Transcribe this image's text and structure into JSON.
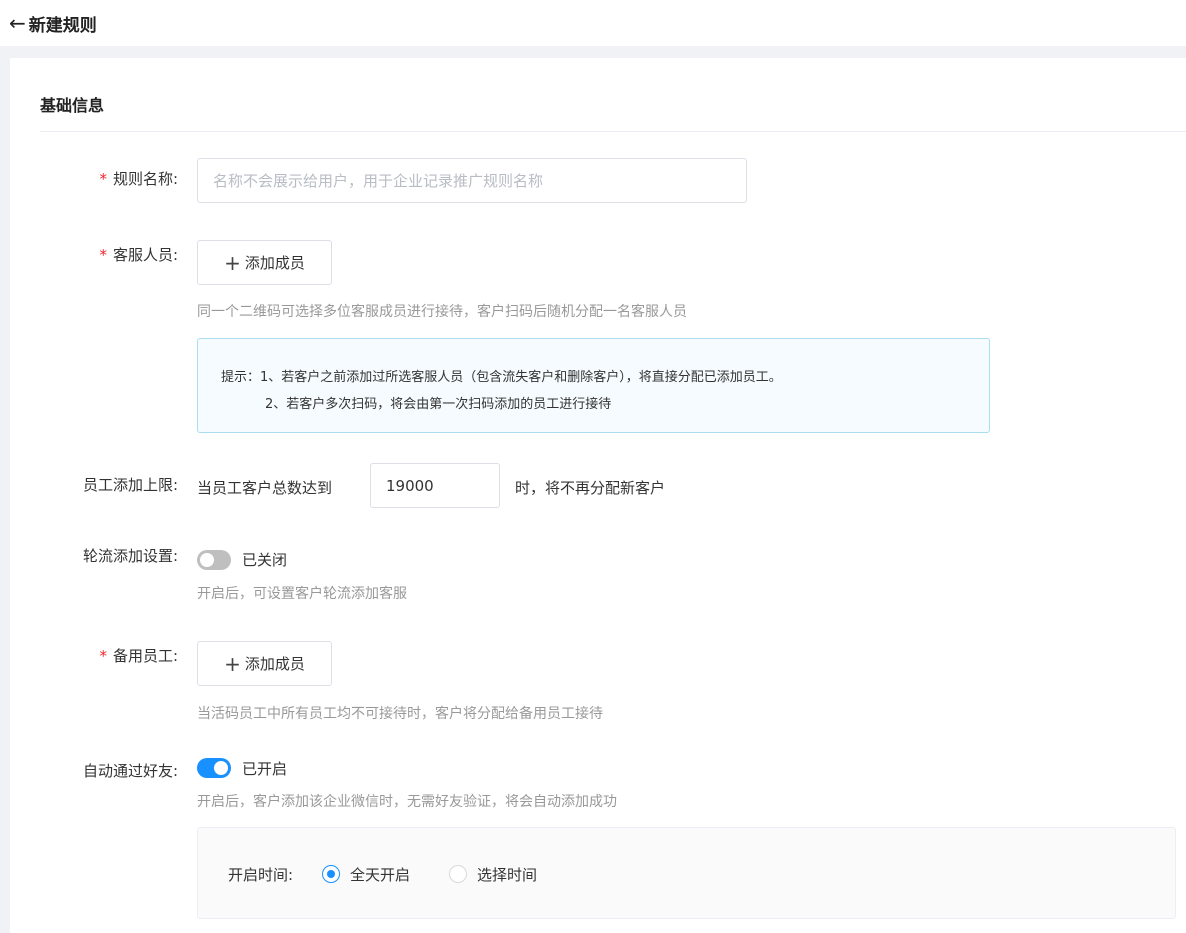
{
  "header": {
    "title": "新建规则"
  },
  "section": {
    "title": "基础信息"
  },
  "rule_name": {
    "label": "规则名称:",
    "placeholder": "名称不会展示给用户，用于企业记录推广规则名称",
    "value": ""
  },
  "service_staff": {
    "label": "客服人员:",
    "add_button": "添加成员",
    "hint": "同一个二维码可选择多位客服成员进行接待，客户扫码后随机分配一名客服人员",
    "tip_line1": "提示：1、若客户之前添加过所选客服人员（包含流失客户和删除客户），将直接分配已添加员工。",
    "tip_line2": "2、若客户多次扫码，将会由第一次扫码添加的员工进行接待"
  },
  "add_limit": {
    "label": "员工添加上限:",
    "prefix": "当员工客户总数达到",
    "value": "19000",
    "suffix": "时，将不再分配新客户"
  },
  "rotation": {
    "label": "轮流添加设置:",
    "enabled": false,
    "state_text": "已关闭",
    "hint": "开启后，可设置客户轮流添加客服"
  },
  "backup_staff": {
    "label": "备用员工:",
    "add_button": "添加成员",
    "hint": "当活码员工中所有员工均不可接待时，客户将分配给备用员工接待"
  },
  "auto_accept": {
    "label": "自动通过好友:",
    "enabled": true,
    "state_text": "已开启",
    "hint": "开启后，客户添加该企业微信时，无需好友验证，将会自动添加成功"
  },
  "open_time": {
    "label": "开启时间:",
    "options": [
      "全天开启",
      "选择时间"
    ],
    "selected": "全天开启"
  },
  "colors": {
    "primary": "#1890ff",
    "required": "#f5222d",
    "tip_border": "#a9ddef",
    "tip_bg": "#f5fbfe"
  }
}
